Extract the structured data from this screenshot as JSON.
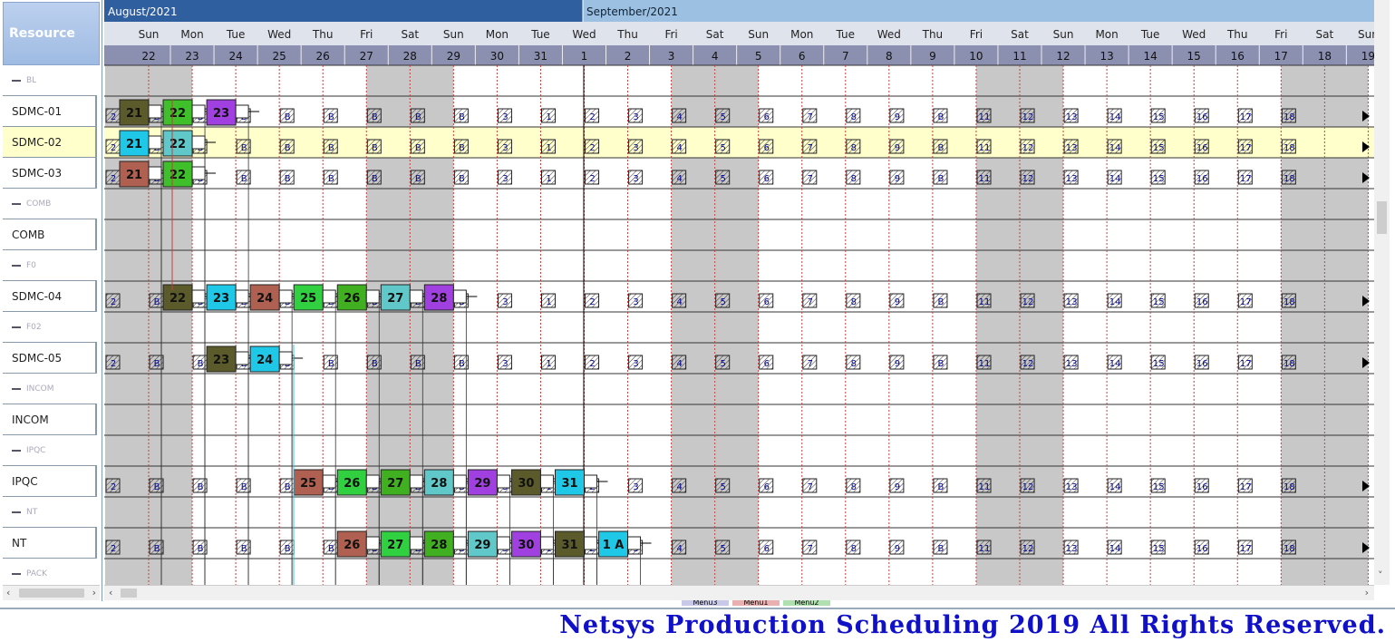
{
  "left_panel": {
    "header": "Resource",
    "rows": [
      {
        "label": "BL",
        "group": true
      },
      {
        "label": "SDMC-01",
        "group": false
      },
      {
        "label": "SDMC-02",
        "group": false,
        "selected": true
      },
      {
        "label": "SDMC-03",
        "group": false
      },
      {
        "label": "COMB",
        "group": true
      },
      {
        "label": "COMB",
        "group": false
      },
      {
        "label": "F0",
        "group": true
      },
      {
        "label": "SDMC-04",
        "group": false
      },
      {
        "label": "F02",
        "group": true
      },
      {
        "label": "SDMC-05",
        "group": false
      },
      {
        "label": "INCOM",
        "group": true
      },
      {
        "label": "INCOM",
        "group": false
      },
      {
        "label": "IPQC",
        "group": true
      },
      {
        "label": "IPQC",
        "group": false
      },
      {
        "label": "NT",
        "group": true
      },
      {
        "label": "NT",
        "group": false
      },
      {
        "label": "PACK",
        "group": true
      }
    ]
  },
  "timeline": {
    "months": [
      "August/2021",
      "September/2021"
    ],
    "days": [
      {
        "dow": "Sun",
        "num": "22",
        "weekend": true
      },
      {
        "dow": "Mon",
        "num": "23",
        "weekend": true
      },
      {
        "dow": "Tue",
        "num": "24"
      },
      {
        "dow": "Wed",
        "num": "25"
      },
      {
        "dow": "Thu",
        "num": "26"
      },
      {
        "dow": "Fri",
        "num": "27"
      },
      {
        "dow": "Sat",
        "num": "28",
        "weekend": true
      },
      {
        "dow": "Sun",
        "num": "29",
        "weekend": true
      },
      {
        "dow": "Mon",
        "num": "30"
      },
      {
        "dow": "Tue",
        "num": "31"
      },
      {
        "dow": "Wed",
        "num": "1"
      },
      {
        "dow": "Thu",
        "num": "2"
      },
      {
        "dow": "Fri",
        "num": "3"
      },
      {
        "dow": "Sat",
        "num": "4",
        "weekend": true
      },
      {
        "dow": "Sun",
        "num": "5",
        "weekend": true
      },
      {
        "dow": "Mon",
        "num": "6"
      },
      {
        "dow": "Tue",
        "num": "7"
      },
      {
        "dow": "Wed",
        "num": "8"
      },
      {
        "dow": "Thu",
        "num": "9"
      },
      {
        "dow": "Fri",
        "num": "10"
      },
      {
        "dow": "Sat",
        "num": "11",
        "weekend": true
      },
      {
        "dow": "Sun",
        "num": "12",
        "weekend": true
      },
      {
        "dow": "Mon",
        "num": "13"
      },
      {
        "dow": "Tue",
        "num": "14"
      },
      {
        "dow": "Wed",
        "num": "15"
      },
      {
        "dow": "Thu",
        "num": "16"
      },
      {
        "dow": "Fri",
        "num": "17"
      },
      {
        "dow": "Sat",
        "num": "18",
        "weekend": true
      },
      {
        "dow": "Sun",
        "num": "19",
        "weekend": true
      }
    ]
  },
  "markers": {
    "resource_rows": [
      1,
      2,
      3,
      7,
      9,
      13,
      15
    ],
    "labels": [
      "2",
      "B",
      "B",
      "B",
      "B",
      "B",
      "B",
      "B",
      "B",
      "3",
      "1",
      "2",
      "3",
      "4",
      "5",
      "6",
      "7",
      "8",
      "9",
      "B",
      "11",
      "12",
      "13",
      "14",
      "15",
      "16",
      "17",
      "18"
    ]
  },
  "tasks": [
    {
      "row": 1,
      "day": 0,
      "label": "21",
      "color": "#5a5a2a"
    },
    {
      "row": 1,
      "day": 1,
      "label": "22",
      "color": "#3fbf2a"
    },
    {
      "row": 1,
      "day": 2,
      "label": "23",
      "color": "#a040e0"
    },
    {
      "row": 2,
      "day": 0,
      "label": "21",
      "color": "#20c8e8"
    },
    {
      "row": 2,
      "day": 1,
      "label": "22",
      "color": "#60c8c8"
    },
    {
      "row": 3,
      "day": 0,
      "label": "21",
      "color": "#b06050"
    },
    {
      "row": 3,
      "day": 1,
      "label": "22",
      "color": "#3fbf2a"
    },
    {
      "row": 7,
      "day": 1,
      "label": "22",
      "color": "#5a5a2a"
    },
    {
      "row": 7,
      "day": 2,
      "label": "23",
      "color": "#20c8e8"
    },
    {
      "row": 7,
      "day": 3,
      "label": "24",
      "color": "#b06050"
    },
    {
      "row": 7,
      "day": 4,
      "label": "25",
      "color": "#30d040"
    },
    {
      "row": 7,
      "day": 5,
      "label": "26",
      "color": "#40b020"
    },
    {
      "row": 7,
      "day": 6,
      "label": "27",
      "color": "#60c8c8"
    },
    {
      "row": 7,
      "day": 7,
      "label": "28",
      "color": "#a040e0"
    },
    {
      "row": 9,
      "day": 2,
      "label": "23",
      "color": "#5a5a2a"
    },
    {
      "row": 9,
      "day": 3,
      "label": "24",
      "color": "#20c8e8"
    },
    {
      "row": 13,
      "day": 4,
      "label": "25",
      "color": "#b06050"
    },
    {
      "row": 13,
      "day": 5,
      "label": "26",
      "color": "#30d040"
    },
    {
      "row": 13,
      "day": 6,
      "label": "27",
      "color": "#40b020"
    },
    {
      "row": 13,
      "day": 7,
      "label": "28",
      "color": "#60c8c8"
    },
    {
      "row": 13,
      "day": 8,
      "label": "29",
      "color": "#a040e0"
    },
    {
      "row": 13,
      "day": 9,
      "label": "30",
      "color": "#5a5a2a"
    },
    {
      "row": 13,
      "day": 10,
      "label": "31",
      "color": "#20c8e8"
    },
    {
      "row": 15,
      "day": 5,
      "label": "26",
      "color": "#b06050"
    },
    {
      "row": 15,
      "day": 6,
      "label": "27",
      "color": "#30d040"
    },
    {
      "row": 15,
      "day": 7,
      "label": "28",
      "color": "#40b020"
    },
    {
      "row": 15,
      "day": 8,
      "label": "29",
      "color": "#60c8c8"
    },
    {
      "row": 15,
      "day": 9,
      "label": "30",
      "color": "#a040e0"
    },
    {
      "row": 15,
      "day": 10,
      "label": "31",
      "color": "#5a5a2a"
    },
    {
      "row": 15,
      "day": 11,
      "label": "1 A",
      "color": "#20c8e8"
    }
  ],
  "bottom_tabs": [
    {
      "label": "Menu3",
      "color": "#c8c8e8"
    },
    {
      "label": "Menu1",
      "color": "#e8b0b0"
    },
    {
      "label": "Menu2",
      "color": "#b0e0b0"
    }
  ],
  "footer": {
    "brand": "Netsys Production Scheduling    2019 All Rights Reserved."
  }
}
